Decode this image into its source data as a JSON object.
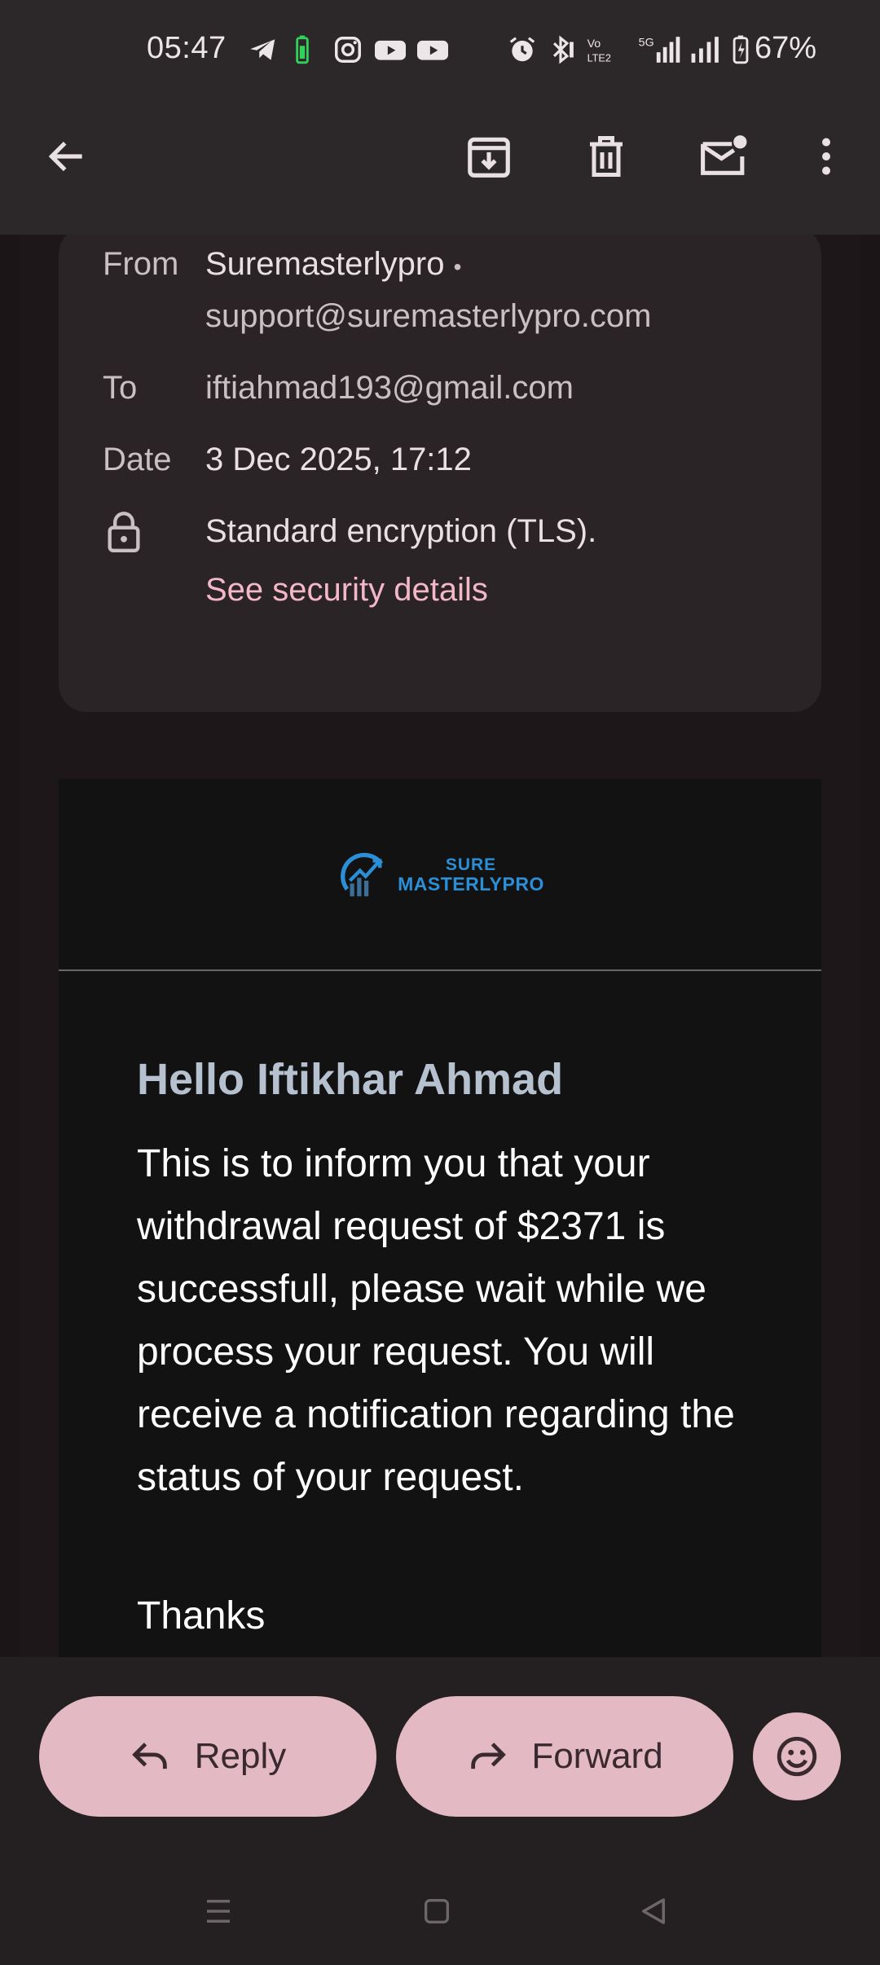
{
  "status_bar": {
    "time": "05:47",
    "battery_percent": "67%",
    "icons": [
      "telegram-icon",
      "battery-saver-icon",
      "instagram-icon",
      "youtube-icon",
      "youtube-icon",
      "alarm-icon",
      "bluetooth-icon",
      "volte-icon",
      "5g-signal-icon",
      "signal-icon",
      "battery-icon"
    ]
  },
  "app_bar": {
    "icons": [
      "back-arrow-icon",
      "archive-icon",
      "delete-icon",
      "mark-unread-icon",
      "more-vert-icon"
    ]
  },
  "email_meta": {
    "from_label": "From",
    "from_name": "Suremasterlypro",
    "from_separator": "•",
    "from_email": "support@suremasterlypro.com",
    "to_label": "To",
    "to_value": "iftiahmad193@gmail.com",
    "date_label": "Date",
    "date_value": "3 Dec 2025, 17:12",
    "encryption": "Standard encryption (TLS).",
    "security_link": "See security details"
  },
  "email_body": {
    "logo_line1": "SURE",
    "logo_line2": "MASTERLYPRO",
    "greeting": "Hello Iftikhar Ahmad",
    "message": "This is to inform you that your withdrawal request of $2371 is successfull, please wait while we process your request. You will receive a notification regarding the status of your request.",
    "closing_partial": "Thanks"
  },
  "actions": {
    "reply_label": "Reply",
    "forward_label": "Forward"
  },
  "colors": {
    "accent_pill": "#e3b9c4",
    "link": "#f4b7c9",
    "logo_blue": "#2a8fd6",
    "greeting": "#b6c1cf"
  }
}
